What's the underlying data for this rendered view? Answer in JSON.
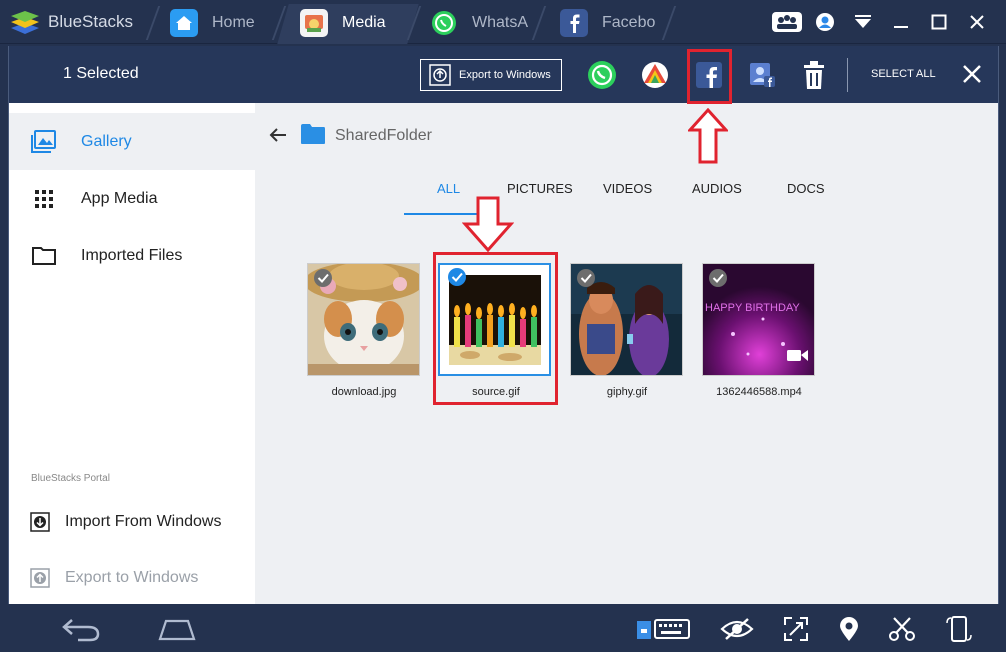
{
  "window": {
    "title": "BlueStacks",
    "tabs": [
      {
        "label": "Home"
      },
      {
        "label": "Media"
      },
      {
        "label": "WhatsA"
      },
      {
        "label": "Facebo"
      }
    ]
  },
  "header": {
    "selected_text": "1 Selected",
    "export_label": "Export to Windows",
    "select_all_label": "SELECT ALL"
  },
  "sidebar": {
    "items": [
      {
        "label": "Gallery"
      },
      {
        "label": "App Media"
      },
      {
        "label": "Imported Files"
      }
    ],
    "portal_label": "BlueStacks Portal",
    "import_label": "Import From Windows",
    "export_label": "Export to Windows"
  },
  "main": {
    "folder_name": "SharedFolder",
    "filter_tabs": [
      {
        "label": "ALL"
      },
      {
        "label": "PICTURES"
      },
      {
        "label": "VIDEOS"
      },
      {
        "label": "AUDIOS"
      },
      {
        "label": "DOCS"
      }
    ],
    "files": [
      {
        "name": "download.jpg"
      },
      {
        "name": "source.gif"
      },
      {
        "name": "giphy.gif"
      },
      {
        "name": "1362446588.mp4"
      }
    ],
    "birthday_text": "HAPPY BIRTHDAY"
  },
  "colors": {
    "accent": "#1e88e5",
    "highlight": "#e0232f",
    "chrome": "#24324f"
  }
}
